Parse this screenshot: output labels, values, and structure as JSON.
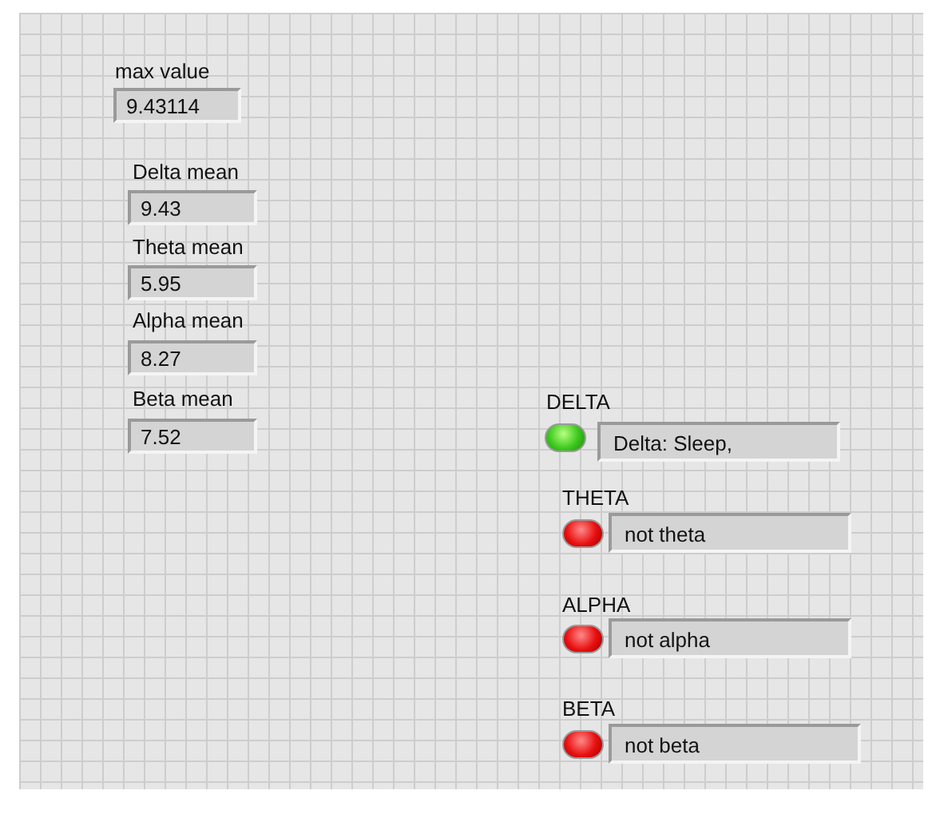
{
  "max_value": {
    "label": "max value",
    "value": "9.43114"
  },
  "means": [
    {
      "label": "Delta mean",
      "value": "9.43"
    },
    {
      "label": "Theta mean",
      "value": "5.95"
    },
    {
      "label": "Alpha mean",
      "value": "8.27"
    },
    {
      "label": "Beta mean",
      "value": "7.52"
    }
  ],
  "bands": [
    {
      "label": "DELTA",
      "on": true,
      "text": "Delta: Sleep,"
    },
    {
      "label": "THETA",
      "on": false,
      "text": "not theta"
    },
    {
      "label": "ALPHA",
      "on": false,
      "text": "not alpha"
    },
    {
      "label": "BETA",
      "on": false,
      "text": "not beta"
    }
  ]
}
